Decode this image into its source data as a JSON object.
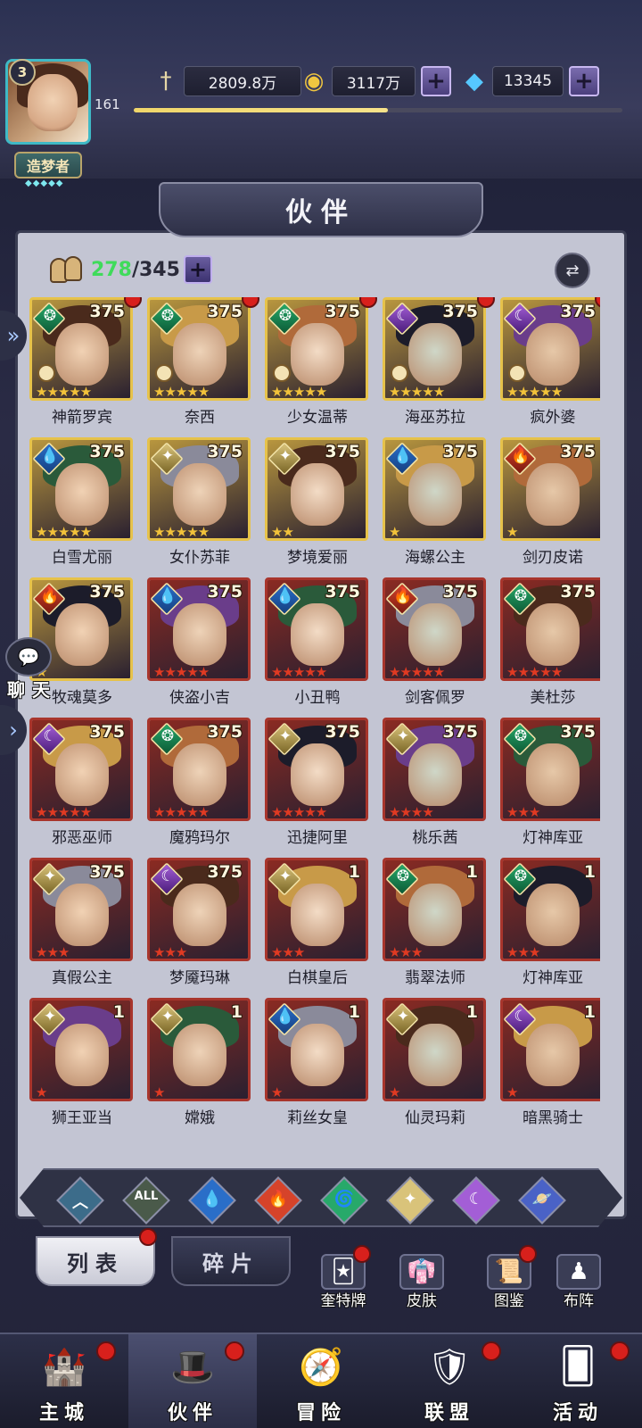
{
  "header": {
    "player_level": "3",
    "player_exp": "161",
    "exp_fraction": 0.52,
    "title": "造梦者",
    "title_stars": "◆◆◆◆◆",
    "power": "2809.8万",
    "gold": "3117万",
    "gems": "13345"
  },
  "panel": {
    "title": "伙伴",
    "count_current": "278",
    "count_max": "345"
  },
  "colors": {
    "water": "#2a6ec8",
    "fire": "#d6432a",
    "nature": "#27a96a",
    "light": "#d9c37a",
    "dark": "#a35ed6",
    "badge": "#d8201c"
  },
  "heroes": [
    {
      "name": "神箭罗宾",
      "level": "375",
      "element": "nature",
      "frame": "gold",
      "stars": "★★★★★",
      "star_color": "gold",
      "dot": true,
      "crest": true
    },
    {
      "name": "奈西",
      "level": "375",
      "element": "nature",
      "frame": "gold",
      "stars": "★★★★★",
      "star_color": "gold",
      "dot": true,
      "crest": true
    },
    {
      "name": "少女温蒂",
      "level": "375",
      "element": "nature",
      "frame": "gold",
      "stars": "★★★★★",
      "star_color": "gold",
      "dot": true,
      "crest": true
    },
    {
      "name": "海巫苏拉",
      "level": "375",
      "element": "dark",
      "frame": "gold",
      "stars": "★★★★★",
      "star_color": "gold",
      "dot": true,
      "crest": true
    },
    {
      "name": "疯外婆",
      "level": "375",
      "element": "dark",
      "frame": "gold",
      "stars": "★★★★★",
      "star_color": "gold",
      "dot": true,
      "crest": true
    },
    {
      "name": "白雪尤丽",
      "level": "375",
      "element": "water",
      "frame": "gold",
      "stars": "★★★★★",
      "star_color": "gold",
      "dot": false,
      "crest": false
    },
    {
      "name": "女仆苏菲",
      "level": "375",
      "element": "light",
      "frame": "gold",
      "stars": "★★★★★",
      "star_color": "gold",
      "dot": false,
      "crest": false
    },
    {
      "name": "梦境爱丽",
      "level": "375",
      "element": "light",
      "frame": "gold",
      "stars": "★★",
      "star_color": "gold",
      "dot": false,
      "crest": false
    },
    {
      "name": "海螺公主",
      "level": "375",
      "element": "water",
      "frame": "gold",
      "stars": "★",
      "star_color": "gold",
      "dot": false,
      "crest": false
    },
    {
      "name": "剑刃皮诺",
      "level": "375",
      "element": "fire",
      "frame": "gold",
      "stars": "★",
      "star_color": "gold",
      "dot": false,
      "crest": false
    },
    {
      "name": "牧魂莫多",
      "level": "375",
      "element": "fire",
      "frame": "gold",
      "stars": "★",
      "star_color": "gold",
      "dot": false,
      "crest": false
    },
    {
      "name": "侠盗小吉",
      "level": "375",
      "element": "water",
      "frame": "red",
      "stars": "★★★★★",
      "star_color": "red",
      "dot": false,
      "crest": false
    },
    {
      "name": "小丑鸭",
      "level": "375",
      "element": "water",
      "frame": "red",
      "stars": "★★★★★",
      "star_color": "red",
      "dot": false,
      "crest": false
    },
    {
      "name": "剑客佩罗",
      "level": "375",
      "element": "fire",
      "frame": "red",
      "stars": "★★★★★",
      "star_color": "red",
      "dot": false,
      "crest": false
    },
    {
      "name": "美杜莎",
      "level": "375",
      "element": "nature",
      "frame": "red",
      "stars": "★★★★★",
      "star_color": "red",
      "dot": false,
      "crest": false
    },
    {
      "name": "邪恶巫师",
      "level": "375",
      "element": "dark",
      "frame": "red",
      "stars": "★★★★★",
      "star_color": "red",
      "dot": false,
      "crest": false
    },
    {
      "name": "魔鸦玛尔",
      "level": "375",
      "element": "nature",
      "frame": "red",
      "stars": "★★★★★",
      "star_color": "red",
      "dot": false,
      "crest": false
    },
    {
      "name": "迅捷阿里",
      "level": "375",
      "element": "light",
      "frame": "red",
      "stars": "★★★★★",
      "star_color": "red",
      "dot": false,
      "crest": false
    },
    {
      "name": "桃乐茜",
      "level": "375",
      "element": "light",
      "frame": "red",
      "stars": "★★★★",
      "star_color": "red",
      "dot": false,
      "crest": false
    },
    {
      "name": "灯神库亚",
      "level": "375",
      "element": "nature",
      "frame": "red",
      "stars": "★★★",
      "star_color": "red",
      "dot": false,
      "crest": false
    },
    {
      "name": "真假公主",
      "level": "375",
      "element": "light",
      "frame": "red",
      "stars": "★★★",
      "star_color": "red",
      "dot": false,
      "crest": false
    },
    {
      "name": "梦魇玛琳",
      "level": "375",
      "element": "dark",
      "frame": "red",
      "stars": "★★★",
      "star_color": "red",
      "dot": false,
      "crest": false
    },
    {
      "name": "白棋皇后",
      "level": "1",
      "element": "light",
      "frame": "red",
      "stars": "★★★",
      "star_color": "red",
      "dot": false,
      "crest": false
    },
    {
      "name": "翡翠法师",
      "level": "1",
      "element": "nature",
      "frame": "red",
      "stars": "★★★",
      "star_color": "red",
      "dot": false,
      "crest": false
    },
    {
      "name": "灯神库亚",
      "level": "1",
      "element": "nature",
      "frame": "red",
      "stars": "★★★",
      "star_color": "red",
      "dot": false,
      "crest": false
    },
    {
      "name": "狮王亚当",
      "level": "1",
      "element": "light",
      "frame": "red",
      "stars": "★",
      "star_color": "red",
      "dot": false,
      "crest": false
    },
    {
      "name": "嫦娥",
      "level": "1",
      "element": "light",
      "frame": "red",
      "stars": "★",
      "star_color": "red",
      "dot": false,
      "crest": false
    },
    {
      "name": "莉丝女皇",
      "level": "1",
      "element": "water",
      "frame": "red",
      "stars": "★",
      "star_color": "red",
      "dot": false,
      "crest": false
    },
    {
      "name": "仙灵玛莉",
      "level": "1",
      "element": "light",
      "frame": "red",
      "stars": "★",
      "star_color": "red",
      "dot": false,
      "crest": false
    },
    {
      "name": "暗黑骑士",
      "level": "1",
      "element": "dark",
      "frame": "red",
      "stars": "★",
      "star_color": "red",
      "dot": false,
      "crest": false
    }
  ],
  "filters": [
    {
      "icon": "arrow-up-icon",
      "glyph": "︿",
      "color": "#3c6c8a"
    },
    {
      "icon": "all-icon",
      "glyph": "ALL",
      "color": "#4a5a4a"
    },
    {
      "icon": "water-icon",
      "glyph": "💧",
      "color": "#2a6ec8"
    },
    {
      "icon": "fire-icon",
      "glyph": "🔥",
      "color": "#d6432a"
    },
    {
      "icon": "nature-icon",
      "glyph": "🌀",
      "color": "#27a96a"
    },
    {
      "icon": "light-icon",
      "glyph": "✦",
      "color": "#d9c37a"
    },
    {
      "icon": "dark-icon",
      "glyph": "☾",
      "color": "#a35ed6"
    },
    {
      "icon": "planet-icon",
      "glyph": "🪐",
      "color": "#4a62c6"
    }
  ],
  "subtabs": {
    "list": "列表",
    "fragments": "碎片"
  },
  "shortcuts": [
    {
      "label": "奎特牌",
      "glyph": "🃏",
      "dot": true
    },
    {
      "label": "皮肤",
      "glyph": "👘",
      "dot": false
    },
    {
      "label": "图鉴",
      "glyph": "📜",
      "dot": true
    },
    {
      "label": "布阵",
      "glyph": "♟",
      "dot": false
    }
  ],
  "nav": [
    {
      "label": "主城",
      "glyph": "🏰",
      "dot": true,
      "active": false
    },
    {
      "label": "伙伴",
      "glyph": "🎩",
      "dot": true,
      "active": true
    },
    {
      "label": "冒险",
      "glyph": "🧭",
      "dot": false,
      "active": false
    },
    {
      "label": "联盟",
      "glyph": "🛡",
      "dot": true,
      "active": false
    },
    {
      "label": "活动",
      "glyph": "🂠",
      "dot": true,
      "active": false
    }
  ],
  "chat_label": "聊天"
}
